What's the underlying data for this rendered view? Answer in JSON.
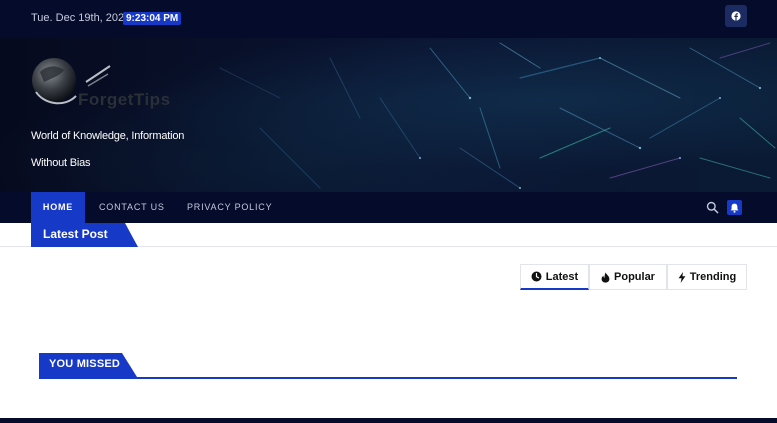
{
  "topbar": {
    "date": "Tue. Dec 19th, 2023",
    "time": "9:23:04 PM",
    "social_icon": "facebook-icon"
  },
  "site": {
    "logo_text": "ForgetTips",
    "tagline_line1": "World of Knowledge, Information",
    "tagline_line2": "Without Bias"
  },
  "nav": {
    "items": [
      {
        "label": "HOME"
      },
      {
        "label": "CONTACT US"
      },
      {
        "label": "PRIVACY POLICY"
      }
    ],
    "search_icon": "search-icon",
    "bell_icon": "bell-icon"
  },
  "latest": {
    "label": "Latest Post"
  },
  "tabs": [
    {
      "label": "Latest",
      "icon": "clock-icon"
    },
    {
      "label": "Popular",
      "icon": "fire-icon"
    },
    {
      "label": "Trending",
      "icon": "bolt-icon"
    }
  ],
  "you_missed": {
    "label": "YOU MISSED"
  },
  "colors": {
    "accent": "#1739c7",
    "dark": "#050b2a"
  }
}
